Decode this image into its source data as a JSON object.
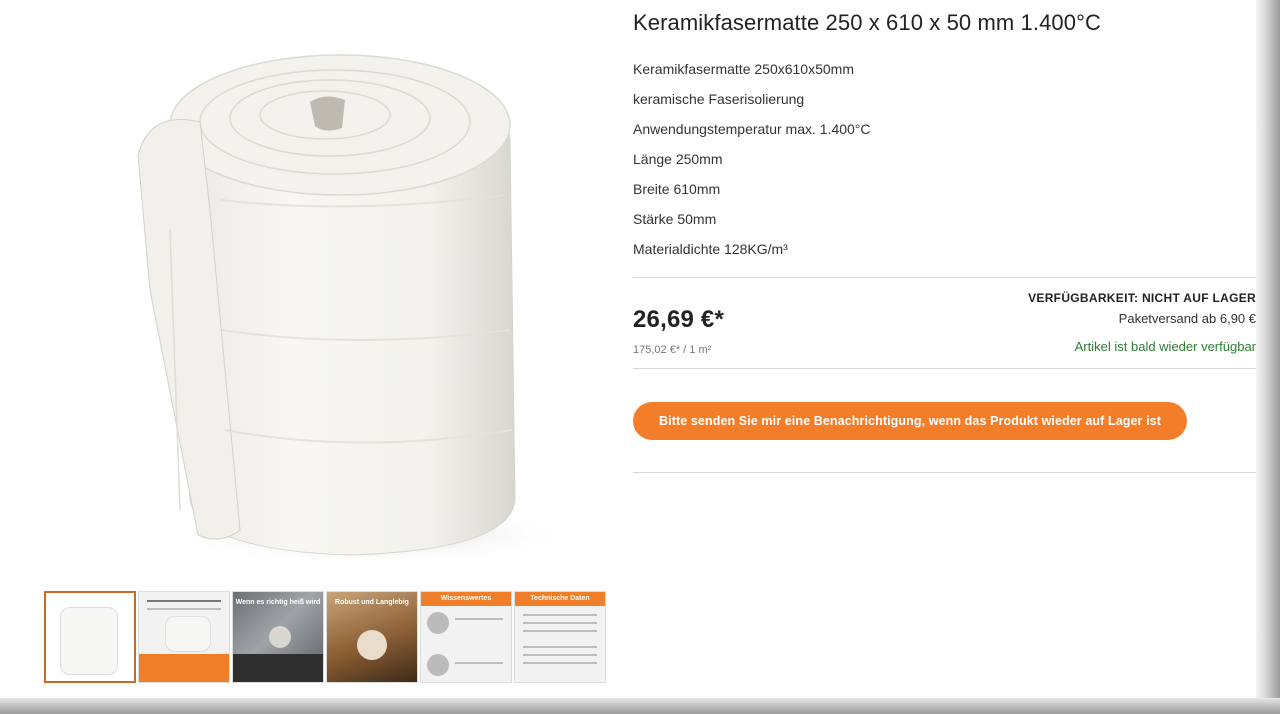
{
  "product": {
    "title": "Keramikfasermatte 250 x 610 x 50 mm 1.400°C",
    "features": [
      "Keramikfasermatte 250x610x50mm",
      "keramische Faserisolierung",
      "Anwendungstemperatur max. 1.400°C",
      "Länge 250mm",
      "Breite 610mm",
      "Stärke 50mm",
      "Materialdichte 128KG/m³"
    ],
    "price": "26,69 €*",
    "unit_price": "175,02 €* / 1 m²",
    "availability_label": "VERFÜGBARKEIT: NICHT AUF LAGER",
    "shipping": "Paketversand ab 6,90 €",
    "restock_note": "Artikel ist bald wieder verfügbar",
    "notify_button_label": "Bitte senden Sie mir eine Benachrichtigung, wenn das Produkt wieder auf Lager ist"
  },
  "gallery": {
    "thumbnails": [
      {
        "caption": ""
      },
      {
        "caption": ""
      },
      {
        "caption": "Wenn es richtig heiß wird"
      },
      {
        "caption": "Robust und Langlebig"
      },
      {
        "caption": "Wissenswertes"
      },
      {
        "caption": "Technische Daten"
      }
    ]
  },
  "colors": {
    "accent": "#f47d2a",
    "in_stock_note": "#2e7d32"
  }
}
